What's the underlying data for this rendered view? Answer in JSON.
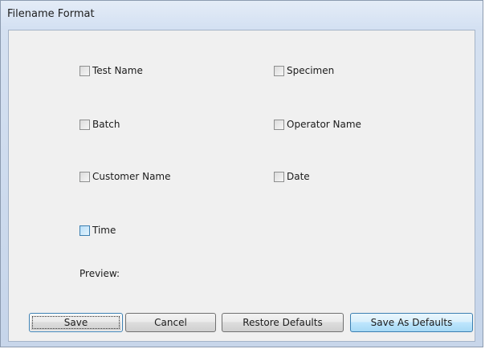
{
  "window": {
    "title": "Filename Format"
  },
  "checkboxes": [
    {
      "label": "Test Name",
      "checked": false
    },
    {
      "label": "Specimen",
      "checked": false
    },
    {
      "label": "Batch",
      "checked": false
    },
    {
      "label": "Operator Name",
      "checked": false
    },
    {
      "label": "Customer Name",
      "checked": false
    },
    {
      "label": "Date",
      "checked": false
    },
    {
      "label": "Time",
      "checked": false
    }
  ],
  "preview": {
    "label": "Preview:",
    "value": ""
  },
  "buttons": {
    "save": "Save",
    "cancel": "Cancel",
    "restore_defaults": "Restore Defaults",
    "save_as_defaults": "Save As Defaults"
  },
  "colors": {
    "title_bar": "#d3e0f2",
    "dialog_background": "#f0f0f0",
    "accent": "#3c7fb1"
  }
}
